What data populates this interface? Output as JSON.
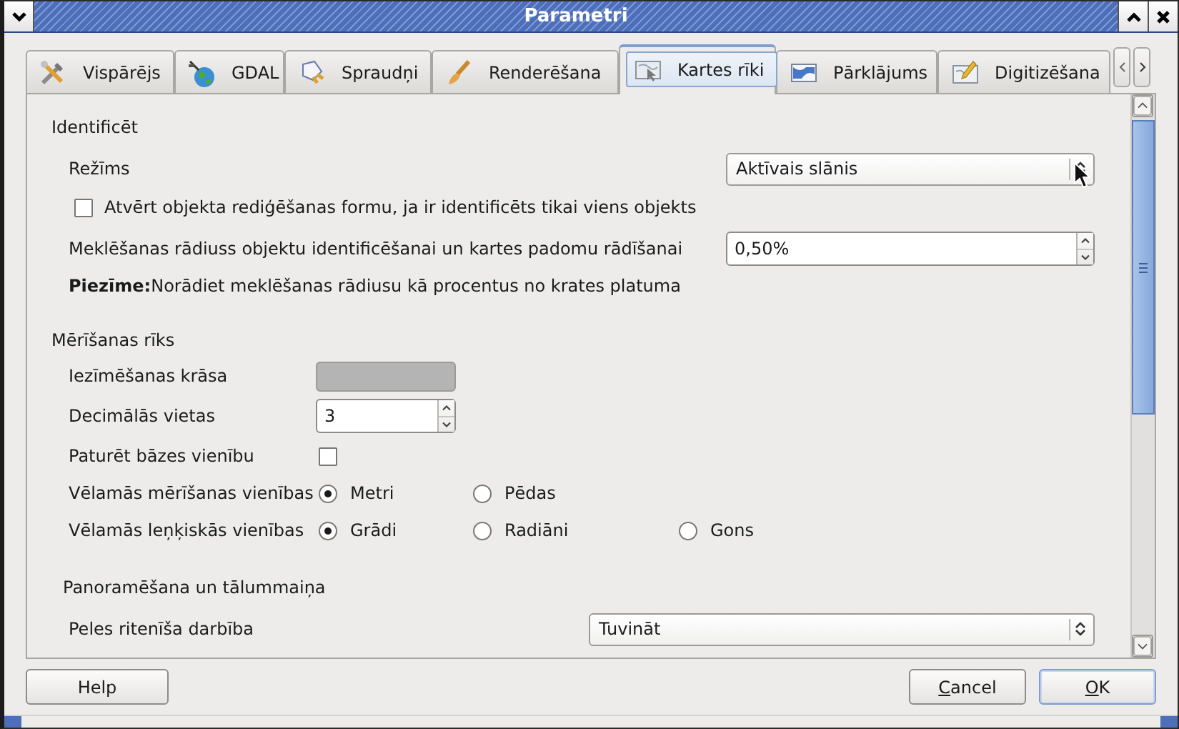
{
  "window": {
    "title": "Parametri"
  },
  "tabs": [
    {
      "label": "Vispārējs",
      "selected": false
    },
    {
      "label": "GDAL",
      "selected": false
    },
    {
      "label": "Spraudņi",
      "selected": false
    },
    {
      "label": "Renderēšana",
      "selected": false
    },
    {
      "label": "Kartes rīki",
      "selected": true
    },
    {
      "label": "Pārklājums",
      "selected": false
    },
    {
      "label": "Digitizēšana",
      "selected": false
    }
  ],
  "identify": {
    "heading": "Identificēt",
    "mode": {
      "label": "Režīms",
      "value": "Aktīvais slānis"
    },
    "open_form": {
      "label": "Atvērt objekta rediģēšanas formu, ja ir identificēts tikai viens objekts",
      "checked": false
    },
    "search_radius": {
      "label": "Meklēšanas rādiuss objektu identificēšanai un kartes padomu rādīšanai",
      "value": "0,50%"
    },
    "note": "**Piezīme:**Norādiet meklēšanas rādiusu kā procentus no krates platuma"
  },
  "measure": {
    "heading": "Mērīšanas rīks",
    "rubberband_color": {
      "label": "Iezīmēšanas krāsa",
      "color": "#b4b4b4"
    },
    "decimal_places": {
      "label": "Decimālās vietas",
      "value": "3"
    },
    "keep_base_unit": {
      "label": "Paturēt bāzes vienību",
      "checked": false
    },
    "measure_units": {
      "label": "Vēlamās mērīšanas vienības",
      "options": [
        {
          "label": "Metri",
          "selected": true
        },
        {
          "label": "Pēdas",
          "selected": false
        }
      ]
    },
    "angle_units": {
      "label": "Vēlamās leņķiskās vienības",
      "options": [
        {
          "label": "Grādi",
          "selected": true
        },
        {
          "label": "Radiāni",
          "selected": false
        },
        {
          "label": "Gons",
          "selected": false
        }
      ]
    }
  },
  "pan_zoom": {
    "heading": "Panoramēšana un tālummaiņa",
    "wheel_action": {
      "label": "Peles ritenīša darbība",
      "value": "Tuvināt"
    }
  },
  "buttons": [
    {
      "label": "Help",
      "mnemonic": false,
      "default": false
    },
    {
      "label": "Cancel",
      "mnemonic": true,
      "default": false
    },
    {
      "label": "OK",
      "mnemonic": true,
      "default": true
    }
  ]
}
